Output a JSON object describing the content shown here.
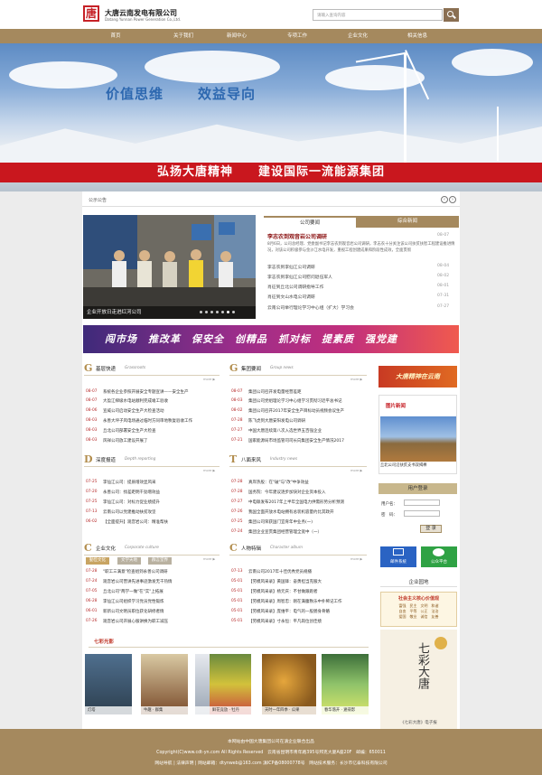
{
  "header": {
    "logo_glyph": "唐",
    "brand_cn": "大唐云南发电有限公司",
    "brand_en": "Datang Yunnan Power Generation Co.,Ltd.",
    "search_placeholder": "请输入查询内容"
  },
  "nav": [
    "首页",
    "关于我们",
    "新闻中心",
    "专项工作",
    "企业文化",
    "相关信息"
  ],
  "banner": {
    "slogan_left": "价值思维",
    "slogan_right": "效益导向",
    "strip": "弘扬大唐精神　　建设国际一流能源集团"
  },
  "notice": {
    "label": "公示公告"
  },
  "slider": {
    "caption": "企业开放日走进红河公司"
  },
  "news": {
    "tab_company": "公司要闻",
    "tab_combined": "综合新闻",
    "headline": "李志农到观音岩公司调研",
    "headline_date": "08-07",
    "summary": "8月6日，公司总经理、党委副书记李志农到观音岩公司调研，李志农十分关注该公司扶贫扶智工程建设推进情况，对该公司积极参与金沙江水电开发，重视工程创建成果和阶段性成效，全面贯彻",
    "rows": [
      {
        "text": "李志农到李仙江公司调研",
        "date": "08-04"
      },
      {
        "text": "李志农到李仙江公司慰问退伍军人",
        "date": "08-02"
      },
      {
        "text": "肖征到丘北公司调研指导工作",
        "date": "08-01"
      },
      {
        "text": "肖征到文山水电公司调研",
        "date": "07-31"
      },
      {
        "text": "云南公司举行理论学习中心组（扩大）学习会",
        "date": "07-27"
      }
    ]
  },
  "ad_banner": "闯市场　推改革　保安全　创精品　抓对标　提素质　强党建",
  "sections": {
    "grassroots": {
      "icon": "G",
      "title": "基层快递",
      "en": "Grassroots",
      "more": "more ▶",
      "items": [
        {
          "date": "08-07",
          "text": "系统各企业参照开展安全专题宣讲——安全生产"
        },
        {
          "date": "08-07",
          "text": "大盈江梯级水电站顺利完成竣工验收"
        },
        {
          "date": "08-06",
          "text": "宣威公司启动安全生产大检查活动"
        },
        {
          "date": "08-03",
          "text": "永善大坪子风电场通过临时方同审地秩复验收工作"
        },
        {
          "date": "08-03",
          "text": "丘北公司部署安全生产大检查"
        },
        {
          "date": "08-03",
          "text": "风祥公司放工建设开展了"
        }
      ]
    },
    "group": {
      "icon": "G",
      "title": "集团要闻",
      "en": "Group news",
      "more": "more ▶",
      "items": [
        {
          "date": "08-07",
          "text": "集团公司召开发电量经营差距"
        },
        {
          "date": "08-03",
          "text": "集团公司党组理论学习中心组学习贯彻习近平总书记"
        },
        {
          "date": "08-02",
          "text": "集团公司召开2017年安全生产目标动员视频会议生产"
        },
        {
          "date": "07-28",
          "text": "陈飞虎到大唐安阳发电公司调研"
        },
        {
          "date": "07-27",
          "text": "中国大唐连续第八次入选世界五百强企业"
        },
        {
          "date": "07-21",
          "text": "国家能源局市场监管司司长向集团安全生产情况2017"
        }
      ]
    },
    "depth": {
      "icon": "D",
      "title": "深度报道",
      "en": "Depth reporting",
      "more": "more ▶",
      "items": [
        {
          "date": "07-25",
          "text": "李仙江公司：提质增效显风采"
        },
        {
          "date": "07-20",
          "text": "永善公司：找差距明干劲增效益"
        },
        {
          "date": "07-25",
          "text": "李仙江公司：对标力促业绩提升"
        },
        {
          "date": "07-13",
          "text": "云南公司以党建推动扶贫攻坚"
        },
        {
          "date": "06-02",
          "text": "【全面提升】观音岩公司：精准帮扶"
        }
      ]
    },
    "industry": {
      "icon": "T",
      "title": "八面来风",
      "en": "Industry news",
      "more": "more ▶",
      "items": [
        {
          "date": "07-28",
          "text": "真岸热股：在\"破\"与\"改\"中争效益"
        },
        {
          "date": "07-28",
          "text": "国务院：今年建议逐步加快对企业资本投入"
        },
        {
          "date": "07-27",
          "text": "中电联发布2017年上半年全国电力供需形势分析预测"
        },
        {
          "date": "07-26",
          "text": "我国全面开放水电站拥有总装机容量约比其政开"
        },
        {
          "date": "07-25",
          "text": "集团公司荣获国门宜育年中业务(一)"
        },
        {
          "date": "07-24",
          "text": "集团企业宣贯集团经营管理全宽中（一）"
        }
      ]
    },
    "culture": {
      "icon": "C",
      "title": "企业文化",
      "en": "Corporate culture",
      "more": "more ▶",
      "tags": [
        "勤俭文化",
        "文学天地",
        "群言堂界"
      ],
      "items": [
        {
          "date": "07-28",
          "text": "\"职工三满意\"检查组到永善公司调研"
        },
        {
          "date": "07-24",
          "text": "观音岩公司营讲先进事迹激发无干热情"
        },
        {
          "date": "07-05",
          "text": "丘北公司\"两学一做\"在\"实\"上拓展"
        },
        {
          "date": "06-28",
          "text": "李仙江公司组织学习党员党性锻炼"
        },
        {
          "date": "06-01",
          "text": "新新公司文明员职位获化研修者情"
        },
        {
          "date": "07-26",
          "text": "观音岩公司开展心服讲换为职工减压"
        }
      ]
    },
    "character": {
      "icon": "C",
      "title": "人物特辑",
      "en": "Character album",
      "more": "more ▶",
      "items": [
        {
          "date": "07-13",
          "text": "云南公司2017年十佳优秀党员规播"
        },
        {
          "date": "05-01",
          "text": "【劳模风采录】黄国锋：奋勇担当克服大"
        },
        {
          "date": "05-01",
          "text": "【劳模风采录】杨元庆：不甘做跟跑者"
        },
        {
          "date": "05-01",
          "text": "【劳模风采录】周智忠：刚在满腹秩乐中扑稀记工作"
        },
        {
          "date": "05-01",
          "text": "【劳模风采录】庞维平：电气的一股肠身骨骼"
        },
        {
          "date": "05-01",
          "text": "【劳模风采录】寸永恒：平凡岗位创佳绩"
        }
      ]
    }
  },
  "right": {
    "banner_text": "大唐精神在云南",
    "pic_news_head": "图片新闻",
    "pic_news_caption": "丘北公司沿扶贫支书双揭棒",
    "login_head": "用户登录",
    "login_user_label": "用户名：",
    "login_pass_label": "密　码：",
    "login_button": "登 录",
    "mail_label": "邮件系统",
    "wechat_label": "公众平台",
    "garden_head": "企业园地",
    "garden_img1_title": "社会主义核心价值观",
    "garden_img1_lines": "富强　民主　文明　和谐\n自由　平等　公正　法治\n爱国　敬业　诚信　友善",
    "garden_img2_title": "七彩大唐",
    "garden_img2_caption": "《七彩大唐》电子报"
  },
  "film": {
    "head": "七彩光影",
    "items": [
      {
        "caption": "灯塔"
      },
      {
        "caption": "牛趣 · 群集"
      },
      {
        "caption": ""
      },
      {
        "caption": "鲜花竞放 · 牡丹"
      },
      {
        "caption": "天时一年四季 · 瓜果"
      },
      {
        "caption": "春华落开 · 遍菊影"
      }
    ]
  },
  "footer": {
    "line1": "本网站由中国大唐集团公司在滇企业联合出品",
    "line2": "Copyright(C)www.cdt-yn.com All Rights Reserved　云南省昆明市青年路395号邦克大厦A座20F　邮编：650011",
    "line3": "网站导航 | 法律声明 | 网站邮箱：dtynweb@163.com 滇ICP备08000778号　网站技术服务：长沙市亿泰科技有限公司"
  }
}
